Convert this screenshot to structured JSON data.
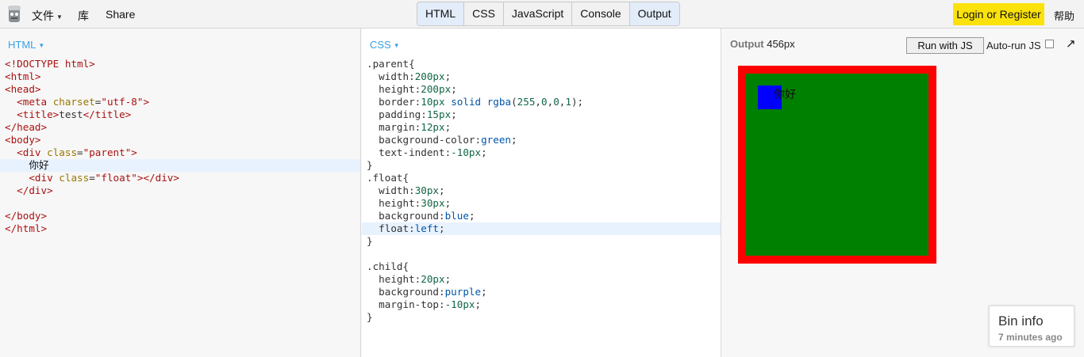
{
  "toolbar": {
    "file_label": "文件",
    "library_label": "库",
    "share_label": "Share",
    "tabs": [
      "HTML",
      "CSS",
      "JavaScript",
      "Console",
      "Output"
    ],
    "login_label": "Login or Register",
    "help_label": "帮助"
  },
  "html_panel": {
    "label": "HTML",
    "code_lines": [
      "<!DOCTYPE html>",
      "<html>",
      "<head>",
      "  <meta charset=\"utf-8\">",
      "  <title>test</title>",
      "</head>",
      "<body>",
      "  <div class=\"parent\">",
      "    你好",
      "    <div class=\"float\"></div>",
      "  </div>",
      "",
      "</body>",
      "</html>"
    ]
  },
  "css_panel": {
    "label": "CSS",
    "code_lines": [
      ".parent{",
      "  width:200px;",
      "  height:200px;",
      "  border:10px solid rgba(255,0,0,1);",
      "  padding:15px;",
      "  margin:12px;",
      "  background-color:green;",
      "  text-indent:-10px;",
      "}",
      ".float{",
      "  width:30px;",
      "  height:30px;",
      "  background:blue;",
      "  float:left;",
      "}",
      "",
      ".child{",
      "  height:20px;",
      "  background:purple;",
      "  margin-top:-10px;",
      "}"
    ]
  },
  "output_panel": {
    "label": "Output",
    "width_label": "456px",
    "run_button_label": "Run with JS",
    "autorun_label": "Auto-run JS",
    "preview_text": "你好",
    "bin_info_title": "Bin info",
    "bin_info_time": "7 minutes ago"
  },
  "colors": {
    "accent": "#3aa0e6",
    "login_bg": "#fbe20b",
    "preview_border": "#ff0000",
    "preview_bg": "#008000",
    "float_bg": "#0000ff"
  }
}
